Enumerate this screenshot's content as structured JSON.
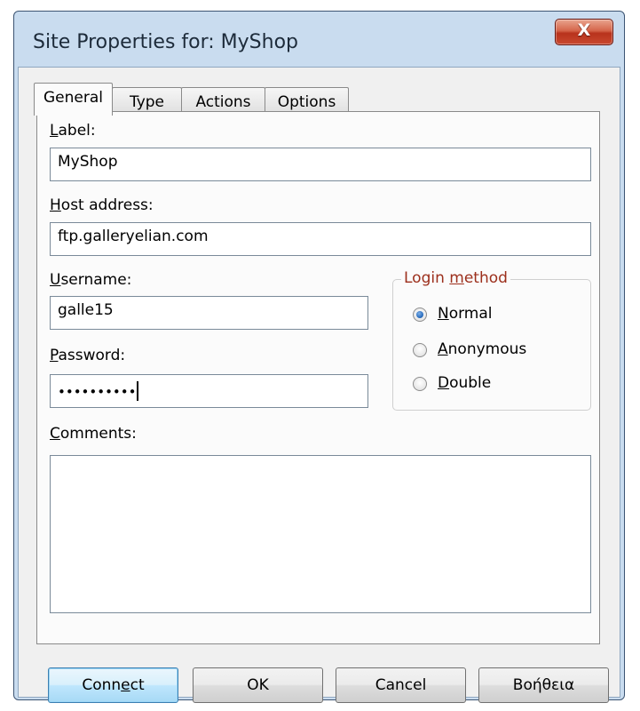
{
  "window": {
    "title": "Site Properties for: MyShop",
    "close_symbol": "X"
  },
  "tabs": [
    {
      "label": "General",
      "active": true
    },
    {
      "label": "Type",
      "active": false
    },
    {
      "label": "Actions",
      "active": false
    },
    {
      "label": "Options",
      "active": false
    }
  ],
  "form": {
    "label": {
      "mnemonic": "L",
      "rest": "abel:",
      "value": "MyShop"
    },
    "host": {
      "mnemonic": "H",
      "rest": "ost address:",
      "value": "ftp.galleryelian.com"
    },
    "username": {
      "mnemonic": "U",
      "rest": "sername:",
      "value": "galle15"
    },
    "password": {
      "mnemonic": "P",
      "rest": "assword:",
      "masked_value": "••••••••••"
    },
    "comments": {
      "mnemonic": "C",
      "rest": "omments:",
      "value": ""
    }
  },
  "login_method": {
    "title_pre": "Login ",
    "title_mnemonic": "m",
    "title_post": "ethod",
    "options": [
      {
        "mnemonic": "N",
        "rest": "ormal",
        "selected": true
      },
      {
        "mnemonic": "A",
        "rest": "nonymous",
        "selected": false
      },
      {
        "mnemonic": "D",
        "rest": "ouble",
        "selected": false
      }
    ]
  },
  "buttons": {
    "connect": {
      "pre": "Conn",
      "mnemonic": "e",
      "post": "ct"
    },
    "ok": "OK",
    "cancel": "Cancel",
    "help": "Βοήθεια"
  },
  "colors": {
    "frame": "#c9dcef",
    "group_title": "#9c2f1c",
    "close_button": "#c9492f"
  }
}
